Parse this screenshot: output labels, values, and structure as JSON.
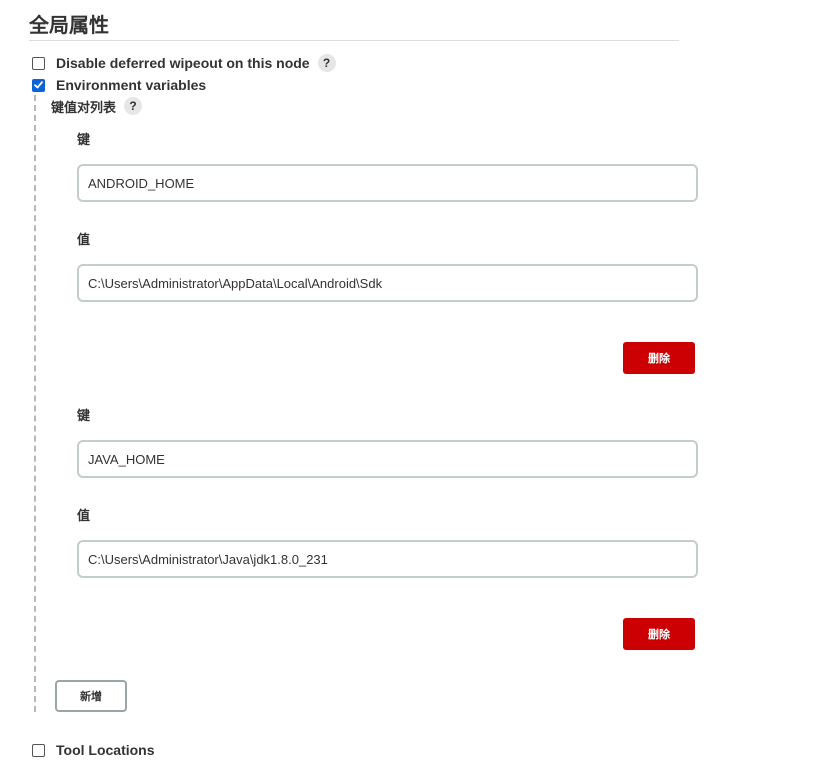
{
  "section": {
    "title": "全局属性"
  },
  "options": {
    "disable_wipeout": {
      "label": "Disable deferred wipeout on this node",
      "checked": false,
      "help": "?"
    },
    "env_vars": {
      "label": "Environment variables",
      "checked": true
    },
    "tool_locations": {
      "label": "Tool Locations",
      "checked": false
    }
  },
  "kv_list": {
    "title": "键值对列表",
    "help": "?",
    "entries": [
      {
        "key_label": "键",
        "key": "ANDROID_HOME",
        "value_label": "值",
        "value": "C:\\Users\\Administrator\\AppData\\Local\\Android\\Sdk",
        "delete_label": "删除"
      },
      {
        "key_label": "键",
        "key": "JAVA_HOME",
        "value_label": "值",
        "value": "C:\\Users\\Administrator\\Java\\jdk1.8.0_231",
        "delete_label": "删除"
      }
    ],
    "add_label": "新增"
  },
  "colors": {
    "checkbox_checked": "#0b63d6",
    "delete_button": "#cc0003",
    "input_border": "#c5cccc"
  }
}
